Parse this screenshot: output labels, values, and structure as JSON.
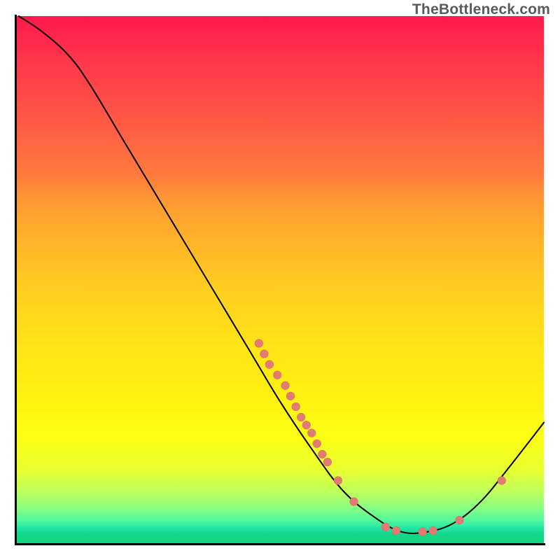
{
  "watermark": "TheBottleneck.com",
  "chart_data": {
    "type": "line",
    "title": "",
    "xlabel": "",
    "ylabel": "",
    "xlim": [
      0,
      100
    ],
    "ylim": [
      0,
      100
    ],
    "grid": false,
    "curve_points": [
      {
        "x": 0.5,
        "y": 100
      },
      {
        "x": 5,
        "y": 97
      },
      {
        "x": 10,
        "y": 92.5
      },
      {
        "x": 14,
        "y": 87
      },
      {
        "x": 20,
        "y": 77
      },
      {
        "x": 26,
        "y": 67
      },
      {
        "x": 32,
        "y": 57
      },
      {
        "x": 38,
        "y": 47
      },
      {
        "x": 44,
        "y": 37
      },
      {
        "x": 50,
        "y": 27
      },
      {
        "x": 56,
        "y": 18
      },
      {
        "x": 62,
        "y": 10
      },
      {
        "x": 68,
        "y": 5
      },
      {
        "x": 73,
        "y": 2.3
      },
      {
        "x": 78,
        "y": 2.3
      },
      {
        "x": 83,
        "y": 4
      },
      {
        "x": 88,
        "y": 8
      },
      {
        "x": 93,
        "y": 14
      },
      {
        "x": 100,
        "y": 23
      }
    ],
    "scatter_points": [
      {
        "x": 46,
        "y": 38,
        "r": 6
      },
      {
        "x": 47,
        "y": 36,
        "r": 6
      },
      {
        "x": 48,
        "y": 34,
        "r": 6
      },
      {
        "x": 49.5,
        "y": 32,
        "r": 6
      },
      {
        "x": 51,
        "y": 30,
        "r": 6
      },
      {
        "x": 52,
        "y": 28,
        "r": 6
      },
      {
        "x": 53,
        "y": 26,
        "r": 6
      },
      {
        "x": 54,
        "y": 24,
        "r": 6
      },
      {
        "x": 55,
        "y": 22.5,
        "r": 6
      },
      {
        "x": 56,
        "y": 21,
        "r": 6
      },
      {
        "x": 57,
        "y": 19,
        "r": 6
      },
      {
        "x": 58,
        "y": 17,
        "r": 6
      },
      {
        "x": 59,
        "y": 15.5,
        "r": 6
      },
      {
        "x": 61,
        "y": 12,
        "r": 6
      },
      {
        "x": 64,
        "y": 8,
        "r": 6
      },
      {
        "x": 70,
        "y": 3.2,
        "r": 6
      },
      {
        "x": 72,
        "y": 2.5,
        "r": 6
      },
      {
        "x": 77,
        "y": 2.3,
        "r": 6
      },
      {
        "x": 79,
        "y": 2.5,
        "r": 6
      },
      {
        "x": 84,
        "y": 4.5,
        "r": 6
      },
      {
        "x": 92,
        "y": 12,
        "r": 6
      }
    ],
    "colors": {
      "curve": "#000000",
      "dot_fill": "#e47a74",
      "dot_stroke": "#c15c56",
      "gradient_top": "#ff1a4d",
      "gradient_bottom": "#0fd37a"
    }
  }
}
